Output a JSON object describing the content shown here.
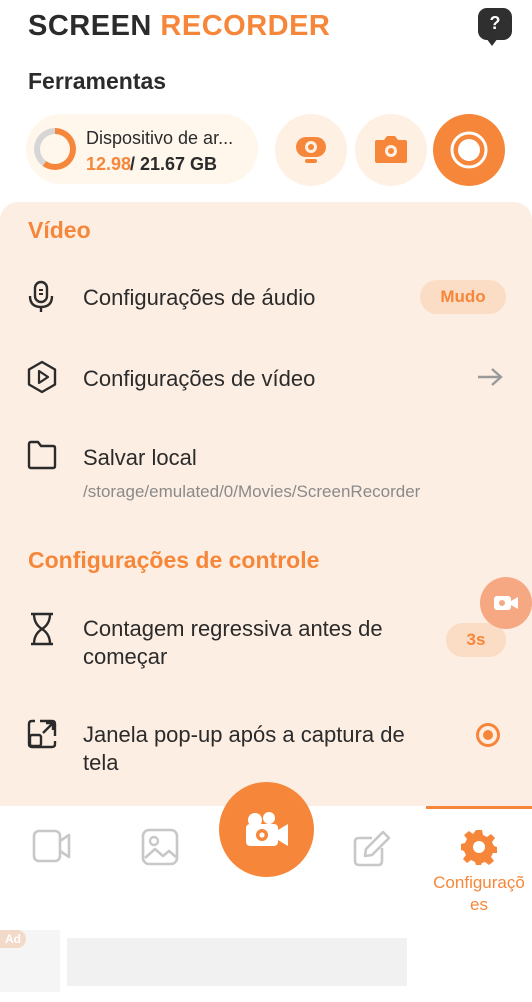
{
  "app": {
    "title_part1": "SCREEN",
    "title_part2": "RECORDER",
    "help_label": "?"
  },
  "tools": {
    "title": "Ferramentas",
    "storage": {
      "label": "Dispositivo de ar...",
      "used": "12.98",
      "total": "/ 21.67 GB",
      "used_fraction": 0.6
    },
    "buttons": [
      {
        "icon": "webcam-icon"
      },
      {
        "icon": "camera-icon"
      },
      {
        "icon": "record-icon",
        "active": true
      }
    ]
  },
  "video_section": {
    "title": "Vídeo",
    "audio": {
      "label": "Configurações de áudio",
      "value": "Mudo",
      "icon": "microphone-icon"
    },
    "video": {
      "label": "Configurações de vídeo",
      "icon": "play-hexagon-icon"
    },
    "save": {
      "label": "Salvar local",
      "path": "/storage/emulated/0/Movies/ScreenRecorder",
      "icon": "folder-icon"
    }
  },
  "control_section": {
    "title": "Configurações de controle",
    "countdown": {
      "label_line1": "Contagem regressiva antes de",
      "label_line2": "começar",
      "value": "3s",
      "icon": "hourglass-icon"
    },
    "popup": {
      "label_line1": "Janela pop-up após a captura de",
      "label_line2": "tela",
      "checked": true,
      "icon": "popup-window-icon"
    }
  },
  "nav": {
    "items": [
      "video-icon",
      "gallery-icon",
      "edit-icon",
      "settings-icon"
    ],
    "active_label_line1": "Configuraçõ",
    "active_label_line2": "es"
  },
  "ad": {
    "badge": "Ad"
  },
  "colors": {
    "accent": "#f6873a",
    "panel_bg": "#fdeee3",
    "text": "#2b2b2b"
  }
}
